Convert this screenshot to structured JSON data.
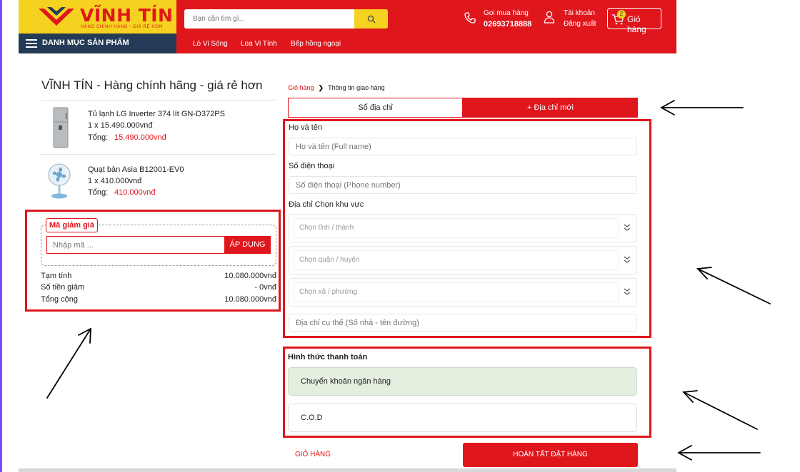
{
  "header": {
    "logo_title": "VĨNH TÍN",
    "logo_subtitle": "HÀNG CHÍNH HÃNG - GIÁ RẺ HƠN",
    "category_label": "DANH MỤC SẢN PHẨM",
    "search_placeholder": "Bạn cần tìm gì...",
    "hotline_label": "Gọi mua hàng",
    "hotline_number": "02693718888",
    "account_label": "Tài khoản",
    "logout_label": "Đăng xuất",
    "cart_label": "Giỏ hàng",
    "cart_count": "2",
    "nav": [
      "Lò Vi Sóng",
      "Loa Vi Tính",
      "Bếp hồng ngoại"
    ],
    "brand_color": "#e0161d",
    "accent_color": "#f5d21f"
  },
  "order": {
    "store_title": "VĨNH TÍN - Hàng chính hãng - giá rẻ hơn",
    "total_label": "Tổng:",
    "items": [
      {
        "name": "Tủ lạnh LG Inverter 374 lít GN-D372PS",
        "qty_price": "1  x  15.490.000vnđ",
        "total": "15.490.000vnđ",
        "icon": "fridge-icon"
      },
      {
        "name": "Quạt bàn Asia B12001-EV0",
        "qty_price": "1  x  410.000vnđ",
        "total": "410.000vnđ",
        "icon": "fan-icon"
      }
    ],
    "coupon": {
      "legend": "Mã giảm giá",
      "placeholder": "Nhập mã ...",
      "apply_label": "ÁP DỤNG"
    },
    "summary": {
      "subtotal_label": "Tạm tính",
      "subtotal_value": "10.080.000vnđ",
      "discount_label": "Số tiền giảm",
      "discount_value": "- 0vnđ",
      "total_label": "Tổng cộng",
      "total_value": "10.080.000vnđ"
    }
  },
  "checkout": {
    "breadcrumb": {
      "cart": "Giỏ hàng",
      "current": "Thông tin giao hàng"
    },
    "tabs": {
      "saved": "Sổ địa chỉ",
      "new": "+ Địa chỉ mới"
    },
    "form": {
      "name_label": "Họ và tên",
      "name_placeholder": "Họ và tên (Full name)",
      "phone_label": "Số điện thoại",
      "phone_placeholder": "Số điện thoại (Phone number)",
      "address_label": "Địa chỉ Chọn khu vực",
      "province_placeholder": "Chọn tỉnh / thành",
      "district_placeholder": "Chọn quận / huyện",
      "ward_placeholder": "Chọn xã / phường",
      "street_placeholder": "Địa chỉ cụ thể (Số nhà - tên đường)"
    },
    "payment": {
      "title": "Hình thức thanh toán",
      "options": [
        "Chuyển khoản ngân hàng",
        "C.O.D"
      ],
      "selected_color": "#e4efe0"
    },
    "back_label": "GIỎ HÀNG",
    "submit_label": "HOÀN TẤT ĐẶT HÀNG"
  }
}
